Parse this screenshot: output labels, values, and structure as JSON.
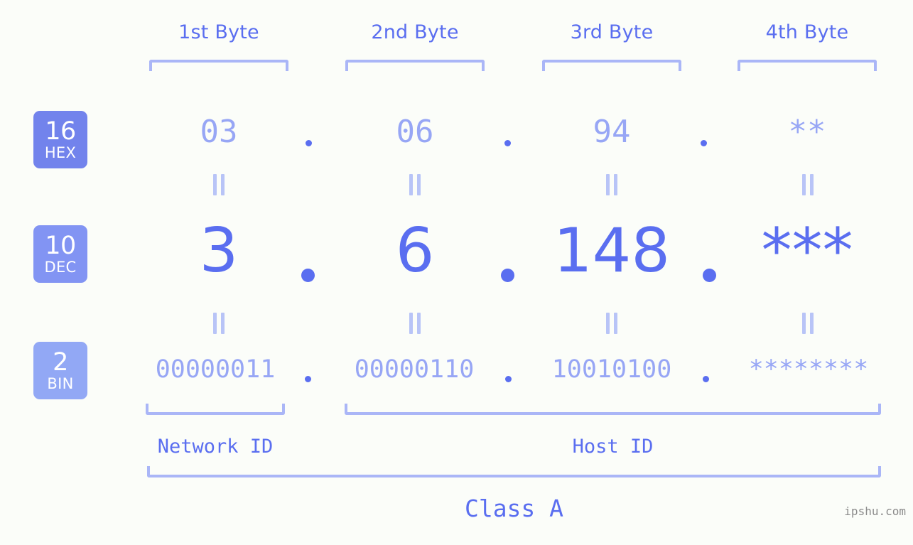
{
  "background_color": "#fbfdf9",
  "accent_color": "#5a6ef0",
  "accent_light_color": "#97a6f5",
  "bracket_color": "#aab6f7",
  "columns": [
    {
      "label": "1st Byte"
    },
    {
      "label": "2nd Byte"
    },
    {
      "label": "3rd Byte"
    },
    {
      "label": "4th Byte"
    }
  ],
  "bases": [
    {
      "number": "16",
      "abbr": "HEX",
      "color": "#7283ec"
    },
    {
      "number": "10",
      "abbr": "DEC",
      "color": "#8294f3"
    },
    {
      "number": "2",
      "abbr": "BIN",
      "color": "#92a8f5"
    }
  ],
  "rows": {
    "hex": {
      "values": [
        "03",
        "06",
        "94",
        "**"
      ]
    },
    "dec": {
      "values": [
        "3",
        "6",
        "148",
        "***"
      ]
    },
    "bin": {
      "values": [
        "00000011",
        "00000110",
        "10010100",
        "********"
      ]
    }
  },
  "separator": ".",
  "equals_symbol": "=",
  "sections": [
    {
      "label": "Network ID"
    },
    {
      "label": "Host ID"
    }
  ],
  "class_label": "Class A",
  "watermark": "ipshu.com"
}
